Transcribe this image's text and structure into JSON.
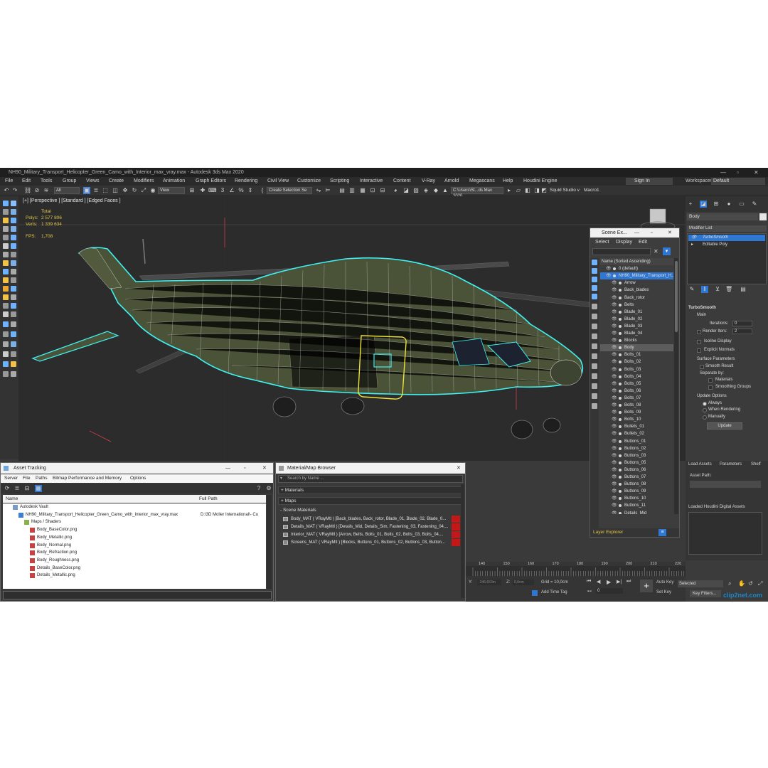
{
  "window": {
    "title": "NH90_Military_Transport_Helicopter_Green_Camo_with_Interior_max_vray.max - Autodesk 3ds Max 2020"
  },
  "menubar": {
    "items": [
      "File",
      "Edit",
      "Tools",
      "Group",
      "Views",
      "Create",
      "Modifiers",
      "Animation",
      "Graph Editors",
      "Rendering",
      "Civil View",
      "Customize",
      "Scripting",
      "Interactive",
      "Content",
      "V-Ray",
      "Arnold",
      "Megascans",
      "Help",
      "Houdini Engine"
    ],
    "sign_in": "Sign In",
    "workspaces_label": "Workspaces:",
    "workspace_value": "Default"
  },
  "toolbar": {
    "selection_filter": "All",
    "ref_coord": "View",
    "create_selection_set": "Create Selection Se",
    "path_field": "C:\\Users\\St...ds Max 2020",
    "squid_studio": "Squid Studio v",
    "macro": "Macro1"
  },
  "viewport": {
    "label": "[+] [Perspective ] [Standard ] [Edged Faces ]",
    "stats_total_label": "Total",
    "polys_label": "Polys:",
    "polys_value": "2 577 806",
    "verts_label": "Verts:",
    "verts_value": "1 339 634",
    "fps_label": "FPS:",
    "fps_value": "1,708"
  },
  "scene_explorer": {
    "title": "Scene Ex...",
    "menu": [
      "Select",
      "Display",
      "Edit"
    ],
    "column_header": "Name (Sorted Ascending)",
    "footer": "Layer Explorer",
    "items": [
      {
        "name": "0 (default)",
        "level": 1
      },
      {
        "name": "NH90_Military_Transport_H...",
        "level": 1,
        "selected": true
      },
      {
        "name": "Arrow",
        "level": 2
      },
      {
        "name": "Back_blades",
        "level": 2
      },
      {
        "name": "Back_rotor",
        "level": 2
      },
      {
        "name": "Belts",
        "level": 2
      },
      {
        "name": "Blade_01",
        "level": 2
      },
      {
        "name": "Blade_02",
        "level": 2
      },
      {
        "name": "Blade_03",
        "level": 2
      },
      {
        "name": "Blade_04",
        "level": 2
      },
      {
        "name": "Blocks",
        "level": 2
      },
      {
        "name": "Body",
        "level": 2,
        "highlight": true
      },
      {
        "name": "Bolts_01",
        "level": 2
      },
      {
        "name": "Bolts_02",
        "level": 2
      },
      {
        "name": "Bolts_03",
        "level": 2
      },
      {
        "name": "Bolts_04",
        "level": 2
      },
      {
        "name": "Bolts_05",
        "level": 2
      },
      {
        "name": "Bolts_06",
        "level": 2
      },
      {
        "name": "Bolts_07",
        "level": 2
      },
      {
        "name": "Bolts_08",
        "level": 2
      },
      {
        "name": "Bolts_09",
        "level": 2
      },
      {
        "name": "Bolts_10",
        "level": 2
      },
      {
        "name": "Bullets_01",
        "level": 2
      },
      {
        "name": "Bullets_02",
        "level": 2
      },
      {
        "name": "Buttons_01",
        "level": 2
      },
      {
        "name": "Buttons_02",
        "level": 2
      },
      {
        "name": "Buttons_03",
        "level": 2
      },
      {
        "name": "Buttons_05",
        "level": 2
      },
      {
        "name": "Buttons_06",
        "level": 2
      },
      {
        "name": "Buttons_07",
        "level": 2
      },
      {
        "name": "Buttons_08",
        "level": 2
      },
      {
        "name": "Buttons_09",
        "level": 2
      },
      {
        "name": "Buttons_10",
        "level": 2
      },
      {
        "name": "Buttons_11",
        "level": 2
      },
      {
        "name": "Details_Mid",
        "level": 2
      }
    ]
  },
  "command_panel": {
    "object_name": "Body",
    "modifier_list": "Modifier List",
    "stack": [
      "TurboSmooth",
      "Editable Poly"
    ],
    "rollout_title": "TurboSmooth",
    "main_label": "Main",
    "iterations_label": "Iterations:",
    "iterations_value": "0",
    "render_iters_label": "Render Iters:",
    "render_iters_value": "2",
    "isoline_display": "Isoline Display",
    "explicit_normals": "Explicit Normals",
    "surface_params_label": "Surface Parameters",
    "smooth_result": "Smooth Result",
    "separate_by": "Separate by:",
    "materials": "Materials",
    "smoothing_groups": "Smoothing Groups",
    "update_options": "Update Options",
    "always": "Always",
    "when_rendering": "When Rendering",
    "manually": "Manually",
    "update_button": "Update",
    "houdini_tabs": [
      "Load Assets",
      "Parameters",
      "Shelf"
    ],
    "asset_path_label": "Asset Path:",
    "loaded_assets_label": "Loaded Houdini Digital Assets"
  },
  "asset_tracking": {
    "title": "Asset Tracking",
    "menu": [
      "Server",
      "File",
      "Paths",
      "Bitmap Performance and Memory",
      "Options"
    ],
    "columns": [
      "Name",
      "Full Path"
    ],
    "rows": [
      {
        "name": "Autodesk Vault",
        "path": "",
        "indent": 1,
        "kind": "vault"
      },
      {
        "name": "NH90_Military_Transport_Helicopter_Green_Camo_with_Interior_max_vray.max",
        "path": "D:\\3D Molier International\\- Cu",
        "indent": 2,
        "kind": "max"
      },
      {
        "name": "Maps / Shaders",
        "path": "",
        "indent": 3,
        "kind": "folder"
      },
      {
        "name": "Body_BaseColor.png",
        "path": "",
        "indent": 4,
        "kind": "png"
      },
      {
        "name": "Body_Metallic.png",
        "path": "",
        "indent": 4,
        "kind": "png"
      },
      {
        "name": "Body_Normal.png",
        "path": "",
        "indent": 4,
        "kind": "png"
      },
      {
        "name": "Body_Refraction.png",
        "path": "",
        "indent": 4,
        "kind": "png"
      },
      {
        "name": "Body_Roughness.png",
        "path": "",
        "indent": 4,
        "kind": "png"
      },
      {
        "name": "Details_BaseColor.png",
        "path": "",
        "indent": 4,
        "kind": "png"
      },
      {
        "name": "Details_Metallic.png",
        "path": "",
        "indent": 4,
        "kind": "png"
      }
    ]
  },
  "material_browser": {
    "title": "Material/Map Browser",
    "search_placeholder": "Search by Name ...",
    "sections": [
      "+ Materials",
      "+ Maps",
      "- Scene Materials"
    ],
    "materials": [
      "Body_MAT ( VRayMtl ) [Back_blades, Back_rotor, Blade_01, Blade_02, Blade_0...",
      "Details_MAT ( VRayMtl ) [Details_Mid, Details_Sim, Fastening_03, Fastening_04,...",
      "Interior_MAT ( VRayMtl ) [Arrow, Belts, Bolts_01, Bolts_02, Bolts_03, Bolts_04,...",
      "Screens_MAT ( VRayMtl ) [Blocks, Buttons_01, Buttons_02, Buttons_03, Button..."
    ]
  },
  "timeline": {
    "ticks": [
      "140",
      "150",
      "160",
      "170",
      "180",
      "190",
      "200",
      "210",
      "220"
    ],
    "x_label": "Y:",
    "x_value": "-346,653m",
    "z_label": "Z:",
    "z_value": "0,0cm",
    "grid_label": "Grid = 10,0cm",
    "add_time_tag": "Add Time Tag",
    "frame_value": "0",
    "auto_key": "Auto Key",
    "selected": "Selected",
    "set_key": "Set Key",
    "key_filters": "Key Filters..."
  },
  "watermark": "clip2net.com",
  "colors": {
    "selection_cyan": "#3ff2f2",
    "selection_yellow": "#f0e23a",
    "wire_white": "#f2f2f2",
    "camo_green": "#4a5238",
    "accent_blue": "#2f77d0",
    "material_red": "#c41818"
  }
}
